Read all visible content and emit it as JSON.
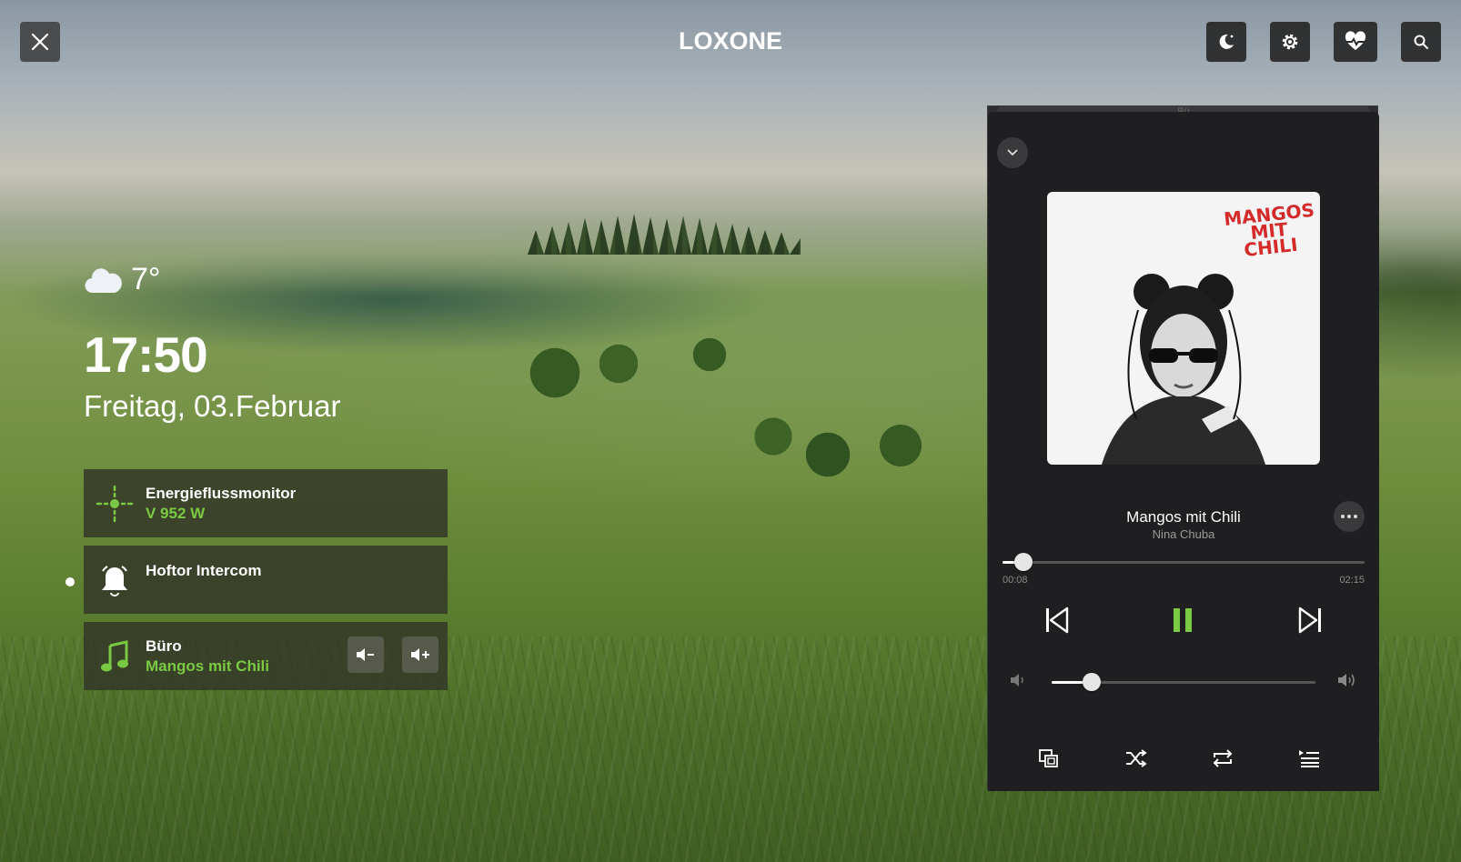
{
  "header": {
    "logo": "LOXONE",
    "buttons": [
      "night-mode-icon",
      "settings-icon",
      "health-icon",
      "search-icon"
    ]
  },
  "weather": {
    "icon": "cloud-icon",
    "temperature": "7°"
  },
  "clock": {
    "time": "17:50",
    "date": "Freitag, 03.Februar"
  },
  "tiles": [
    {
      "title": "Energieflussmonitor",
      "subtitle": "V 952 W",
      "icon": "energy-flow-icon"
    },
    {
      "title": "Hoftor Intercom",
      "subtitle": "",
      "icon": "bell-icon"
    },
    {
      "title": "Büro",
      "subtitle": "Mangos mit Chili",
      "icon": "music-note-icon"
    }
  ],
  "player": {
    "room_label": "Bü",
    "cover_text": "MANGOS MIT CHILI",
    "title": "Mangos mit Chili",
    "artist": "Nina Chuba",
    "elapsed": "00:08",
    "duration": "02:15",
    "progress_fraction": 0.059,
    "volume_fraction": 0.15,
    "accent_color": "#7ac943"
  }
}
